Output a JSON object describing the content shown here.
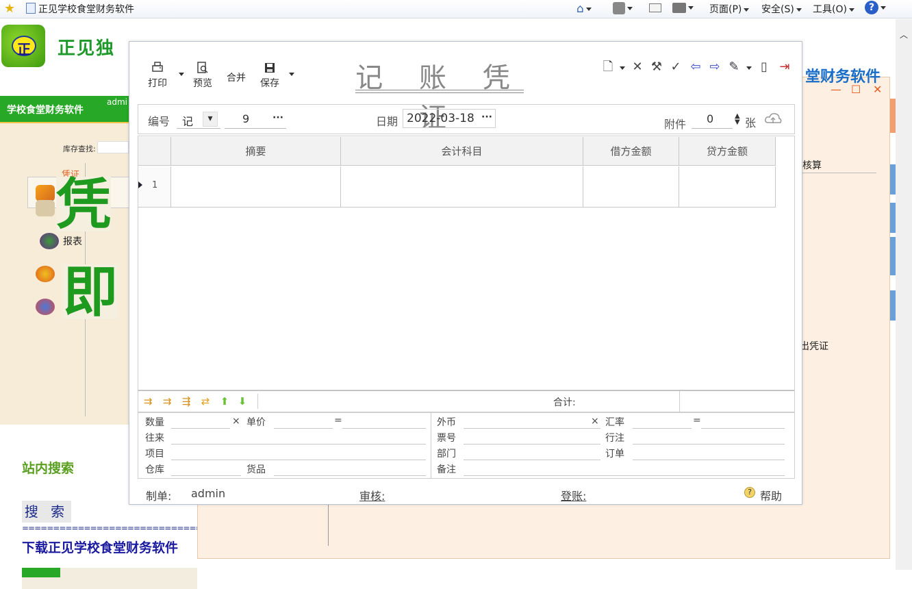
{
  "browser": {
    "tab_title": "正见学校食堂财务软件",
    "menus": {
      "page": "页面(P)",
      "safety": "安全(S)",
      "tools": "工具(O)"
    }
  },
  "site": {
    "logo_char": "正",
    "brand": "正见独",
    "left_header": "学校食堂财务软件",
    "user": "admi",
    "search_label": "库存查找:",
    "nav": {
      "voucher": "凭证",
      "report": "报表",
      "partial_i": "i"
    },
    "big_chars": [
      "凭",
      "即"
    ],
    "site_search": "站内搜索",
    "search_button": "搜 索",
    "divider": "============================================",
    "download": "下载正见学校食堂财务软件",
    "right_title": "堂财务软件",
    "right_hesuan": "核算",
    "right_voucher": "出凭证"
  },
  "dialog": {
    "title": "记 账 凭 证",
    "toolbar": {
      "print": "打印",
      "preview": "预览",
      "merge": "合并",
      "save": "保存"
    },
    "header": {
      "number_label": "编号",
      "number_type": "记",
      "number": "9",
      "date_label": "日期",
      "date": "2022-03-18",
      "attach_label": "附件",
      "attach_count": "0",
      "attach_unit": "张"
    },
    "grid": {
      "columns": [
        "摘要",
        "会计科目",
        "借方金额",
        "贷方金额"
      ],
      "rows": [
        {
          "index": "1",
          "summary": "",
          "account": "",
          "debit": "",
          "credit": ""
        }
      ]
    },
    "total_label": "合计:",
    "footer_left": {
      "qty": "数量",
      "times": "×",
      "price": "单价",
      "eq": "=",
      "partner": "往来",
      "project": "项目",
      "warehouse": "仓库",
      "goods": "货品"
    },
    "footer_right": {
      "currency": "外币",
      "times": "×",
      "rate": "汇率",
      "eq": "=",
      "ticket": "票号",
      "note_line": "行注",
      "dept": "部门",
      "order": "订单",
      "remark": "备注"
    },
    "sign": {
      "maker_label": "制单:",
      "maker": "admin",
      "audit_label": "审核:",
      "post_label": "登账:",
      "help": "帮助"
    }
  }
}
